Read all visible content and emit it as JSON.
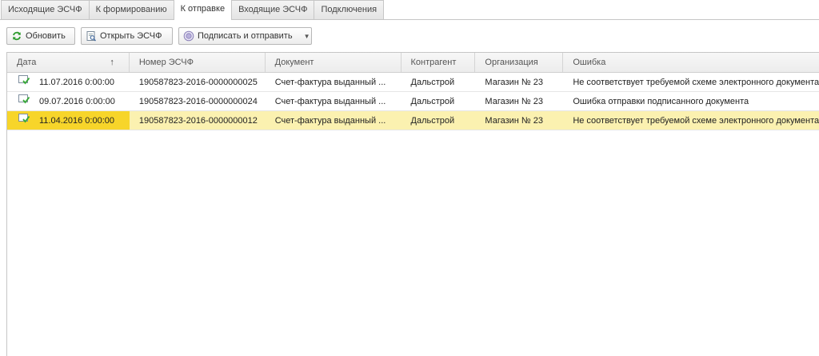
{
  "tabs": [
    {
      "label": "Исходящие ЭСЧФ"
    },
    {
      "label": "К формированию"
    },
    {
      "label": "К отправке",
      "active": true
    },
    {
      "label": "Входящие ЭСЧФ"
    },
    {
      "label": "Подключения"
    }
  ],
  "toolbar": {
    "refresh_label": "Обновить",
    "refresh_icon": "refresh-icon",
    "open_label": "Открыть ЭСЧФ",
    "open_icon": "open-document-icon",
    "sign_label": "Подписать и отправить",
    "sign_icon": "sign-icon"
  },
  "table": {
    "columns": [
      "Дата",
      "Номер ЭСЧФ",
      "Документ",
      "Контрагент",
      "Организация",
      "Ошибка"
    ],
    "sort_indicator": "↑",
    "rows": [
      {
        "date": "11.07.2016 0:00:00",
        "number": "190587823-2016-0000000025",
        "document": "Счет-фактура выданный ...",
        "counterparty": "Дальстрой",
        "organization": "Магазин № 23",
        "error": "Не соответствует требуемой схеме электронного документа",
        "selected": false
      },
      {
        "date": "09.07.2016 0:00:00",
        "number": "190587823-2016-0000000024",
        "document": "Счет-фактура выданный ...",
        "counterparty": "Дальстрой",
        "organization": "Магазин № 23",
        "error": "Ошибка отправки подписанного документа",
        "selected": false
      },
      {
        "date": "11.04.2016 0:00:00",
        "number": "190587823-2016-0000000012",
        "document": "Счет-фактура выданный ...",
        "counterparty": "Дальстрой",
        "organization": "Магазин № 23",
        "error": "Не соответствует требуемой схеме электронного документа",
        "selected": true
      }
    ]
  },
  "colors": {
    "selected_row": "#fbf1b0",
    "selected_cell": "#f7d52a",
    "refresh_icon": "#2e9b2e"
  }
}
